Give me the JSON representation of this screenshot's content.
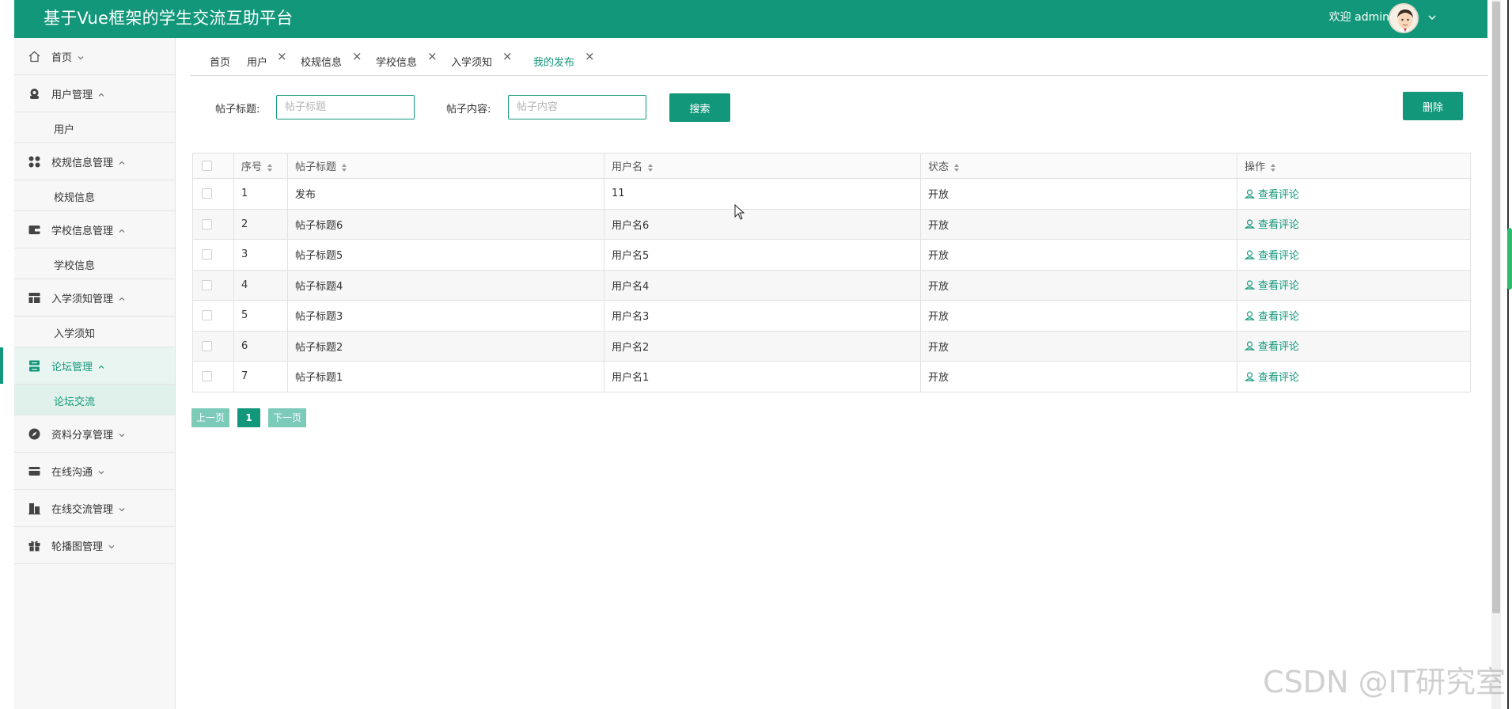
{
  "app": {
    "title": "基于Vue框架的学生交流互助平台",
    "welcome": "欢迎 admin"
  },
  "sidebar": {
    "items": [
      {
        "label": "首页",
        "icon": "home-icon",
        "arrow": "down",
        "children": []
      },
      {
        "label": "用户管理",
        "icon": "user-icon",
        "arrow": "up",
        "children": [
          {
            "label": "用户"
          }
        ]
      },
      {
        "label": "校规信息管理",
        "icon": "grid-icon",
        "arrow": "up",
        "children": [
          {
            "label": "校规信息"
          }
        ]
      },
      {
        "label": "学校信息管理",
        "icon": "wallet-icon",
        "arrow": "up",
        "children": [
          {
            "label": "学校信息"
          }
        ]
      },
      {
        "label": "入学须知管理",
        "icon": "layout-icon",
        "arrow": "up",
        "children": [
          {
            "label": "入学须知"
          }
        ]
      },
      {
        "label": "论坛管理",
        "icon": "server-icon",
        "arrow": "up",
        "active": true,
        "children": [
          {
            "label": "论坛交流",
            "active": true
          }
        ]
      },
      {
        "label": "资料分享管理",
        "icon": "compass-icon",
        "arrow": "down",
        "children": []
      },
      {
        "label": "在线沟通",
        "icon": "card-icon",
        "arrow": "down",
        "children": []
      },
      {
        "label": "在线交流管理",
        "icon": "building-icon",
        "arrow": "down",
        "children": []
      },
      {
        "label": "轮播图管理",
        "icon": "gift-icon",
        "arrow": "down",
        "children": []
      }
    ]
  },
  "tabs": [
    {
      "label": "首页",
      "closable": false
    },
    {
      "label": "用户",
      "closable": true
    },
    {
      "label": "校规信息",
      "closable": true
    },
    {
      "label": "学校信息",
      "closable": true
    },
    {
      "label": "入学须知",
      "closable": true
    },
    {
      "label": "我的发布",
      "closable": true,
      "active": true
    }
  ],
  "search": {
    "title_label": "帖子标题:",
    "title_placeholder": "帖子标题",
    "content_label": "帖子内容:",
    "content_placeholder": "帖子内容",
    "search_button": "搜索",
    "delete_button": "删除"
  },
  "table": {
    "columns": [
      "序号",
      "帖子标题",
      "用户名",
      "状态",
      "操作"
    ],
    "rows": [
      {
        "no": "1",
        "title": "发布",
        "user": "11",
        "status": "开放",
        "action": "查看评论"
      },
      {
        "no": "2",
        "title": "帖子标题6",
        "user": "用户名6",
        "status": "开放",
        "action": "查看评论"
      },
      {
        "no": "3",
        "title": "帖子标题5",
        "user": "用户名5",
        "status": "开放",
        "action": "查看评论"
      },
      {
        "no": "4",
        "title": "帖子标题4",
        "user": "用户名4",
        "status": "开放",
        "action": "查看评论"
      },
      {
        "no": "5",
        "title": "帖子标题3",
        "user": "用户名3",
        "status": "开放",
        "action": "查看评论"
      },
      {
        "no": "6",
        "title": "帖子标题2",
        "user": "用户名2",
        "status": "开放",
        "action": "查看评论"
      },
      {
        "no": "7",
        "title": "帖子标题1",
        "user": "用户名1",
        "status": "开放",
        "action": "查看评论"
      }
    ]
  },
  "pagination": {
    "prev": "上一页",
    "current": "1",
    "next": "下一页"
  },
  "watermark": "CSDN @IT研究室",
  "colors": {
    "primary": "#12977a",
    "primary_light": "#7ccab8",
    "sidebar_bg": "#f7f7f7"
  }
}
